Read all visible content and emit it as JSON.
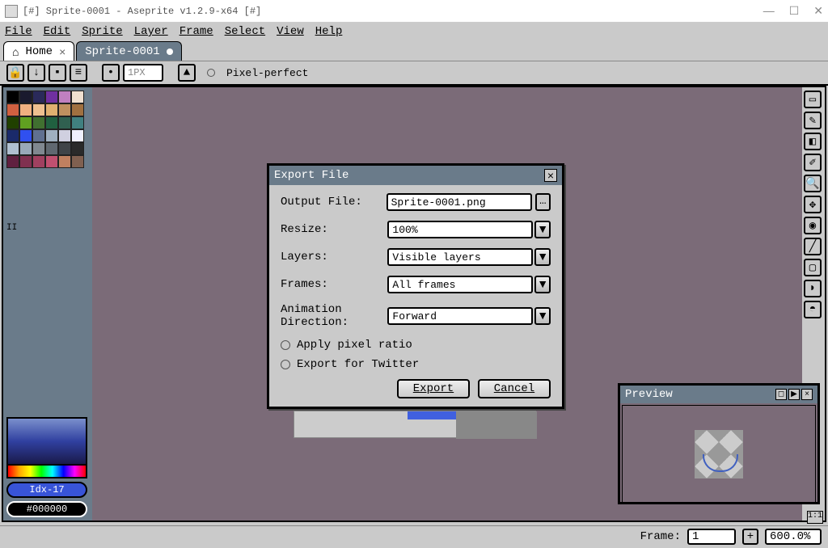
{
  "window": {
    "title": "[#] Sprite-0001 - Aseprite v1.2.9-x64 [#]"
  },
  "menu": {
    "file": "File",
    "edit": "Edit",
    "sprite": "Sprite",
    "layer": "Layer",
    "frame": "Frame",
    "select": "Select",
    "view": "View",
    "help": "Help"
  },
  "tabs": {
    "home": "Home",
    "active": "Sprite-0001"
  },
  "toolbar": {
    "brush_size": "1PX",
    "pixel_perfect": "Pixel-perfect"
  },
  "palette": {
    "colors": [
      "#000000",
      "#1a1a2e",
      "#2a2a5a",
      "#7030a0",
      "#c080c0",
      "#f0e0d0",
      "#d06040",
      "#f0b080",
      "#eec090",
      "#e0b070",
      "#c09060",
      "#a07040",
      "#204000",
      "#60a020",
      "#407030",
      "#206040",
      "#306050",
      "#408080",
      "#1a2a6a",
      "#3050f0",
      "#607090",
      "#a0b0c0",
      "#d0d0e0",
      "#f0f0ff",
      "#b0c0d0",
      "#98a8b8",
      "#808890",
      "#606870",
      "#404448",
      "#2a2a2a",
      "#602040",
      "#803050",
      "#a04060",
      "#c05070",
      "#c08060",
      "#806050"
    ],
    "idx_mark": "II"
  },
  "color_info": {
    "idx": "Idx-17",
    "hex": "#000000"
  },
  "dialog": {
    "title": "Export File",
    "output_label": "Output File:",
    "output_value": "Sprite-0001.png",
    "resize_label": "Resize:",
    "resize_value": "100%",
    "layers_label": "Layers:",
    "layers_value": "Visible layers",
    "frames_label": "Frames:",
    "frames_value": "All frames",
    "anim_label": "Animation Direction:",
    "anim_value": "Forward",
    "apply_ratio": "Apply pixel ratio",
    "export_twitter": "Export for Twitter",
    "export_btn": "Export",
    "cancel_btn": "Cancel"
  },
  "preview": {
    "title": "Preview"
  },
  "status": {
    "frame_label": "Frame:",
    "frame_value": "1",
    "zoom": "600.0%",
    "ratio": "1:1"
  }
}
